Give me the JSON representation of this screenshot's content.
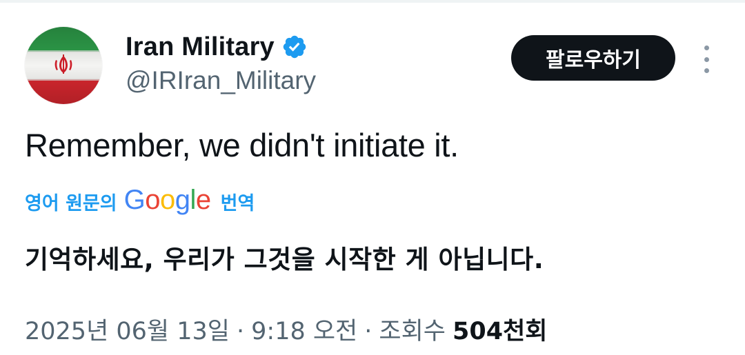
{
  "author": {
    "display_name": "Iran Military",
    "handle": "@IRIran_Military",
    "verified_icon": "verified-badge-icon",
    "avatar": "iran-flag-avatar"
  },
  "actions": {
    "follow_label": "팔로우하기",
    "more_icon": "more-options-icon"
  },
  "tweet": {
    "text": "Remember, we didn't initiate it."
  },
  "translation": {
    "prefix": "영어 원문의",
    "provider": "Google",
    "suffix": "번역",
    "text": "기억하세요, 우리가 그것을 시작한 게 아닙니다."
  },
  "meta": {
    "date": "2025년 06월 13일",
    "separator": "·",
    "time": "9:18 오전",
    "views_label_prefix": "조회수",
    "views_count": "504천회"
  },
  "colors": {
    "accent": "#1d9bf0",
    "text_primary": "#0f1419",
    "text_secondary": "#536471",
    "button_bg": "#0f1419",
    "flag_green": "#239f40",
    "flag_red": "#da0000",
    "flag_emblem": "#da0000",
    "google_blue": "#4285f4",
    "google_red": "#ea4335",
    "google_yellow": "#fbbc05",
    "google_green": "#34a853"
  }
}
